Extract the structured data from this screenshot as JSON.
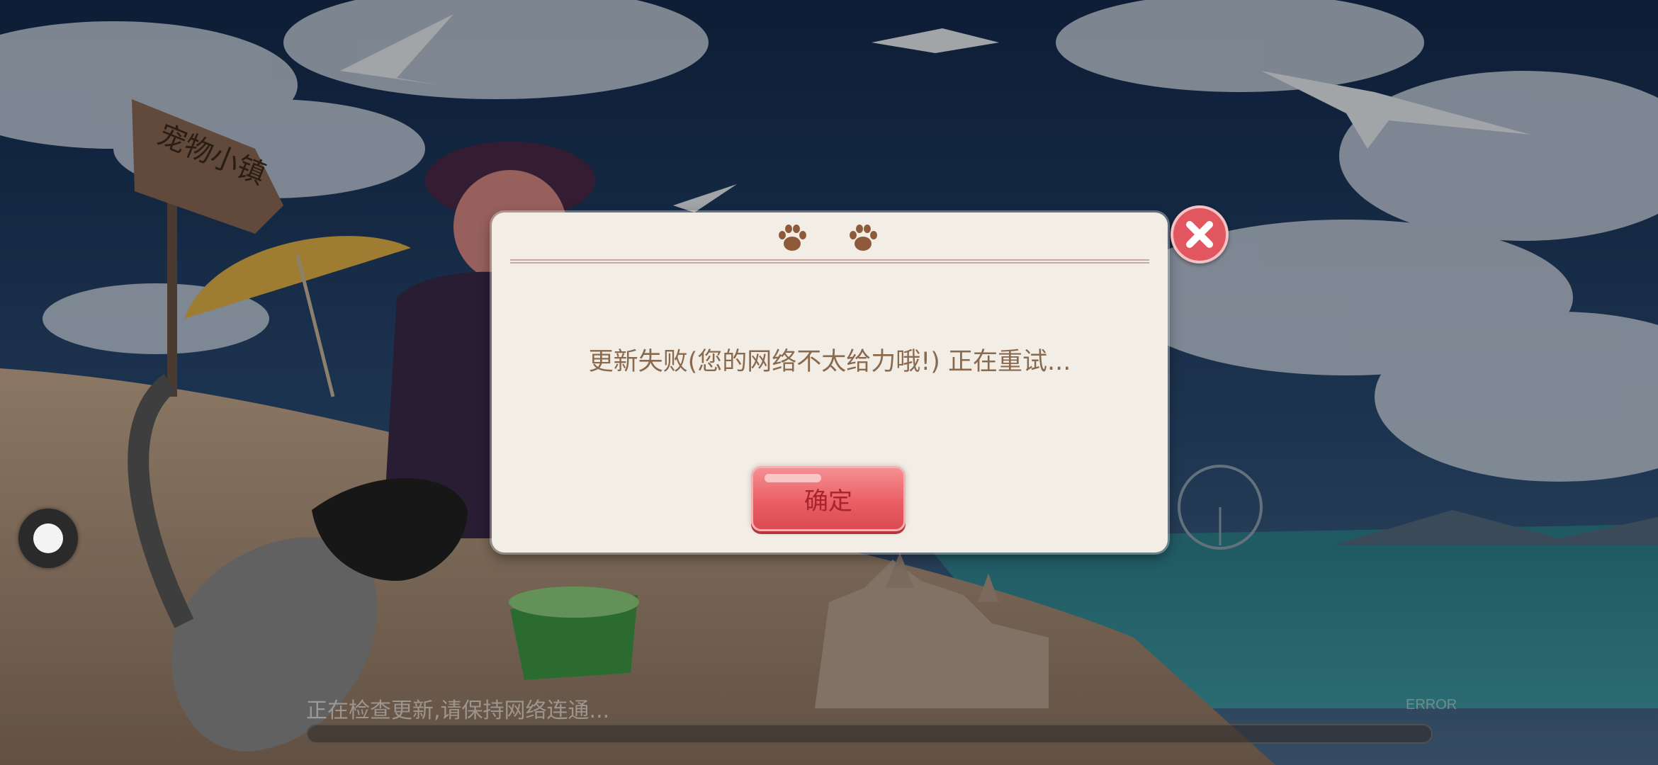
{
  "game": {
    "sign_text": "宠物小镇"
  },
  "dialog": {
    "message": "更新失败(您的网络不太给力哦!) 正在重试...",
    "confirm_label": "确定",
    "icons": [
      "paw-icon",
      "paw-icon",
      "close-icon"
    ]
  },
  "loading": {
    "status_text": "正在检查更新,请保持网络连通...",
    "error_label": "ERROR",
    "progress": 0
  },
  "colors": {
    "dialog_background": "#f2eee6",
    "message_text": "#8a6a4f",
    "confirm_button": "#ea5f65",
    "close_button": "#e2575f"
  }
}
